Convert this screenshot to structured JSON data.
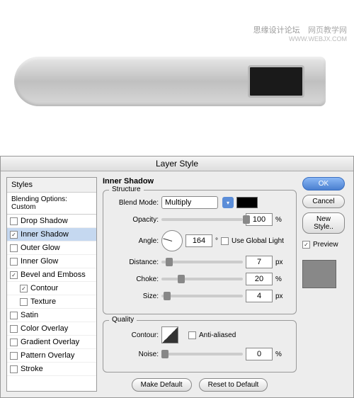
{
  "watermark": {
    "text1": "思缘设计论坛",
    "text2": "网页教学网",
    "url": "WWW.WEBJX.COM"
  },
  "dialog": {
    "title": "Layer Style"
  },
  "styles": {
    "header": "Styles",
    "subheader": "Blending Options: Custom",
    "items": [
      {
        "label": "Drop Shadow",
        "checked": false,
        "selected": false,
        "indent": false
      },
      {
        "label": "Inner Shadow",
        "checked": true,
        "selected": true,
        "indent": false
      },
      {
        "label": "Outer Glow",
        "checked": false,
        "selected": false,
        "indent": false
      },
      {
        "label": "Inner Glow",
        "checked": false,
        "selected": false,
        "indent": false
      },
      {
        "label": "Bevel and Emboss",
        "checked": true,
        "selected": false,
        "indent": false
      },
      {
        "label": "Contour",
        "checked": true,
        "selected": false,
        "indent": true
      },
      {
        "label": "Texture",
        "checked": false,
        "selected": false,
        "indent": true
      },
      {
        "label": "Satin",
        "checked": false,
        "selected": false,
        "indent": false
      },
      {
        "label": "Color Overlay",
        "checked": false,
        "selected": false,
        "indent": false
      },
      {
        "label": "Gradient Overlay",
        "checked": false,
        "selected": false,
        "indent": false
      },
      {
        "label": "Pattern Overlay",
        "checked": false,
        "selected": false,
        "indent": false
      },
      {
        "label": "Stroke",
        "checked": false,
        "selected": false,
        "indent": false
      }
    ]
  },
  "innerShadow": {
    "title": "Inner Shadow",
    "structure": {
      "label": "Structure",
      "blendMode": {
        "label": "Blend Mode:",
        "value": "Multiply"
      },
      "opacity": {
        "label": "Opacity:",
        "value": "100",
        "unit": "%"
      },
      "angle": {
        "label": "Angle:",
        "value": "164",
        "unit": "°",
        "globalLight": "Use Global Light",
        "globalChecked": false
      },
      "distance": {
        "label": "Distance:",
        "value": "7",
        "unit": "px"
      },
      "choke": {
        "label": "Choke:",
        "value": "20",
        "unit": "%"
      },
      "size": {
        "label": "Size:",
        "value": "4",
        "unit": "px"
      }
    },
    "quality": {
      "label": "Quality",
      "contour": {
        "label": "Contour:",
        "antiAliased": "Anti-aliased",
        "aaChecked": false
      },
      "noise": {
        "label": "Noise:",
        "value": "0",
        "unit": "%"
      }
    },
    "makeDefault": "Make Default",
    "resetDefault": "Reset to Default"
  },
  "buttons": {
    "ok": "OK",
    "cancel": "Cancel",
    "newStyle": "New Style..",
    "preview": "Preview"
  }
}
